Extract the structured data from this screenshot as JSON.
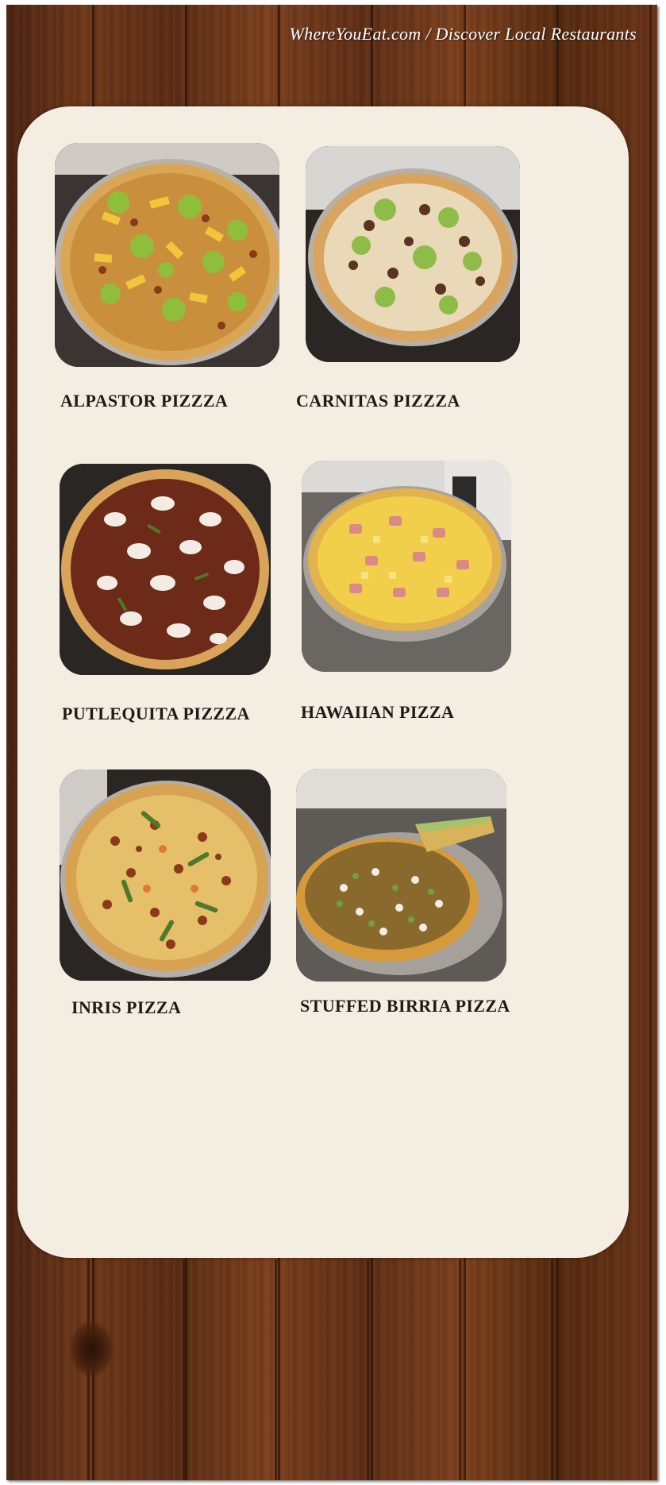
{
  "header": {
    "site_credit": "WhereYouEat.com / Discover Local Restaurants"
  },
  "menu": {
    "items": [
      {
        "name": "ALPASTOR PIZZZA",
        "photo_icon": "pizza-alpastor"
      },
      {
        "name": "CARNITAS PIZZZA",
        "photo_icon": "pizza-carnitas"
      },
      {
        "name": "PUTLEQUITA PIZZZA",
        "photo_icon": "pizza-putlequita"
      },
      {
        "name": "HAWAIIAN PIZZA",
        "photo_icon": "pizza-hawaiian"
      },
      {
        "name": "INRIS PIZZA",
        "photo_icon": "pizza-inris"
      },
      {
        "name": "STUFFED BIRRIA PIZZA",
        "photo_icon": "pizza-stuffed-birria"
      }
    ]
  },
  "colors": {
    "card_background": "#f4ede2",
    "wood_dark": "#4a2212",
    "wood_light": "#7a3e1d",
    "label_text": "#1e1a17"
  }
}
